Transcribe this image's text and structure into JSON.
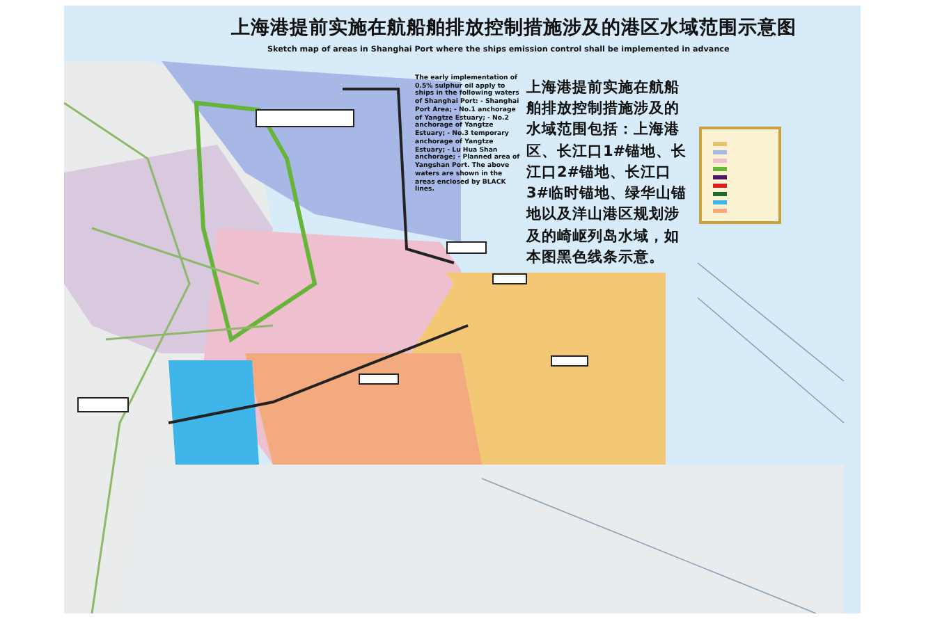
{
  "map": {
    "title": "上海港提前实施在航船舶排放控制措施涉及的港区水域范围示意图",
    "subtitle": "Sketch map of areas in Shanghai Port where the ships emission control shall be implemented in advance",
    "note": "The early implementation of 0.5% sulphur oil apply to ships in the following waters of Shanghai Port: - Shanghai Port Area; - No.1 anchorage of Yangtze Estuary; - No.2 anchorage of Yangtze Estuary; - No.3 temporary anchorage of Yangtze Estuary; - Lu Hua Shan anchorage; - Planned area of Yangshan Port. The above waters are shown in the areas enclosed by BLACK lines.",
    "description": "上海港提前实施在航船舶排放控制措施涉及的水域范围包括：上海港区、长江口1#锚地、长江口2#锚地、长江口3#临时锚地、绿华山锚地以及洋山港区规划涉及的崎岖列岛水域，如本图黑色线条示意。"
  }
}
